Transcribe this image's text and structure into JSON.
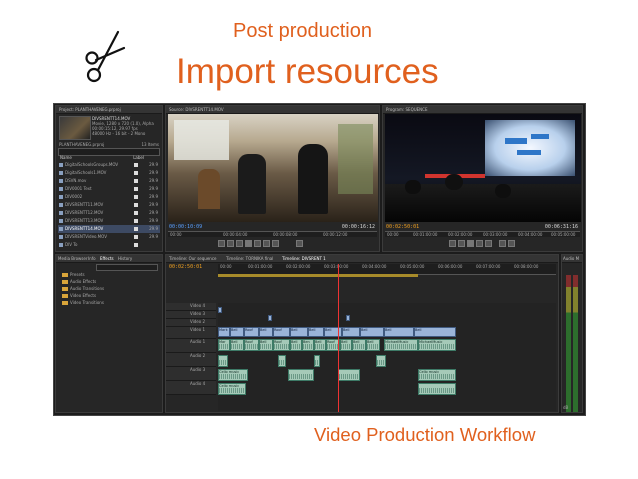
{
  "slide": {
    "subtitle": "Post production",
    "title": "Import resources",
    "footer": "Video Production Workflow",
    "accent_color": "#e0601e",
    "icon": "scissors-icon"
  },
  "premiere": {
    "project": {
      "tab": "Project: PLANTHAVENEG.prproj",
      "preview_name": "DIVSRENTT14.MOV",
      "preview_info": [
        "Movie, 1280 x 720 (1.0), Alpha",
        "00:00:15:12, 29.97 fps",
        "48000 Hz - 16 bit - 2 Mono"
      ],
      "path": "PLANTHAVENEG.prproj",
      "items_count": "13 Items",
      "col_name": "Name",
      "col_label": "Label",
      "files": [
        {
          "name": "DigitalSchoolsGroups.MOV",
          "fps": "29.9"
        },
        {
          "name": "DigitalSchools1.MOV",
          "fps": "29.9"
        },
        {
          "name": "DSVN.mov",
          "fps": "29.9"
        },
        {
          "name": "DIV0001 Text",
          "fps": "29.9"
        },
        {
          "name": "DIV0002",
          "fps": "29.9"
        },
        {
          "name": "DIVSRENTT11.MOV",
          "fps": "29.9"
        },
        {
          "name": "DIVSRENTT12.MOV",
          "fps": "29.9"
        },
        {
          "name": "DIVSRENTT13.MOV",
          "fps": "29.9"
        },
        {
          "name": "DIVSRENTT14.MOV",
          "fps": "29.9"
        },
        {
          "name": "DIVSRENTVideo.MOV",
          "fps": "29.9"
        },
        {
          "name": "DIV To",
          "fps": ""
        }
      ],
      "selected_index": 8
    },
    "effects": {
      "tabs": [
        "Media Browser",
        "Info",
        "Effects",
        "History"
      ],
      "folders": [
        "Presets",
        "Audio Effects",
        "Audio Transitions",
        "Video Effects",
        "Video Transitions"
      ]
    },
    "source": {
      "tab": "Source: DIVSRENTT14.MOV",
      "tc_left": "00:00:10:09",
      "tc_right": "00:00:16:12",
      "ruler": [
        "00:00",
        "00:00:04:00",
        "00:00:08:00",
        "00:00:12:00"
      ]
    },
    "program": {
      "tab": "Program: SEQUENCE",
      "tc_left": "00:02:50:01",
      "tc_right": "00:06:31:16",
      "ruler": [
        "00:00",
        "00:01:00:00",
        "00:02:00:00",
        "00:03:00:00",
        "00:04:00:00",
        "00:05:00:00"
      ]
    },
    "timeline": {
      "tabs": [
        "Timeline: Our sequence",
        "Timeline: TORNIKA final",
        "Timeline: DIVSRENT 1"
      ],
      "timecode": "00:02:50:01",
      "ruler": [
        "00:00",
        "00:01:00:00",
        "00:02:00:00",
        "00:03:00:00",
        "00:04:00:00",
        "00:05:00:00",
        "00:06:00:00",
        "00:07:00:00",
        "00:08:00:00"
      ],
      "tracks": [
        "Video 4",
        "Video 3",
        "Video 2",
        "Video 1",
        "Audio 1",
        "Audio 2",
        "Audio 3",
        "Audio 4"
      ],
      "video_clips": [
        "Mark",
        "Bell",
        "Roof",
        "Bell",
        "Roof",
        "Bell",
        "Bell",
        "Bell",
        "Bell",
        "Bell",
        "Bell",
        "Bell"
      ],
      "audio_clips_1": [
        "Mar",
        "Bell",
        "Roof",
        "Bell",
        "Roof",
        "Bell",
        "Ben",
        "Bell",
        "Roof",
        "Bell",
        "Bell",
        "Bell",
        "MichaelMusic",
        "MichaelMusic"
      ],
      "audio_clips_3": [
        "Cello music",
        "Cello music",
        "Cello music"
      ]
    },
    "audio_meter": {
      "tab": "Audio M",
      "scale": [
        "0",
        "-6",
        "-12",
        "-18",
        "-24",
        "-30",
        "-36",
        "-42",
        "-48",
        "-54",
        "dB"
      ]
    }
  }
}
